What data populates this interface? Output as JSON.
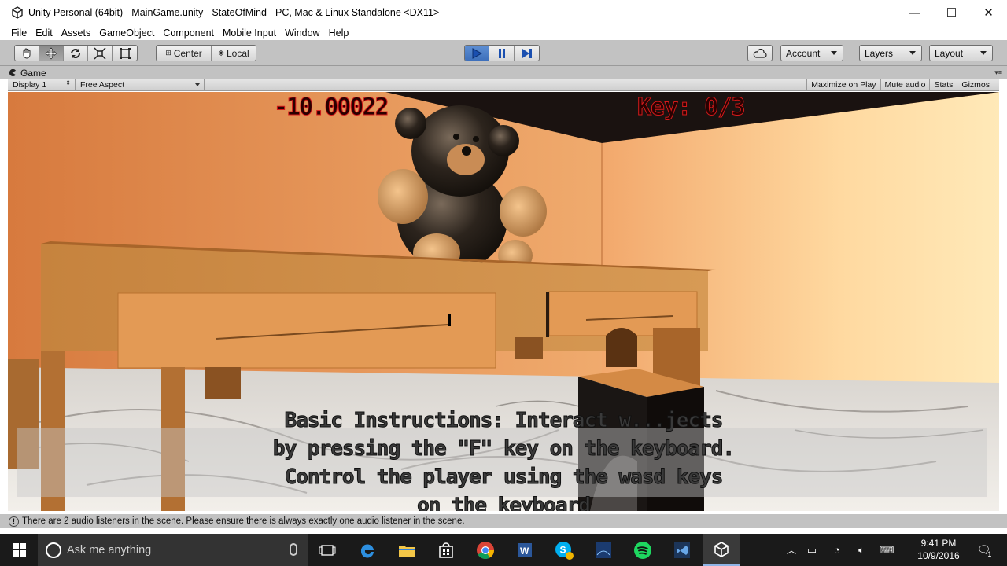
{
  "window": {
    "title": "Unity Personal (64bit) - MainGame.unity - StateOfMind - PC, Mac & Linux Standalone <DX11>",
    "minimize_glyph": "—",
    "maximize_glyph": "☐",
    "close_glyph": "✕"
  },
  "menu": [
    "File",
    "Edit",
    "Assets",
    "GameObject",
    "Component",
    "Mobile Input",
    "Window",
    "Help"
  ],
  "toolbar": {
    "transform_tools": [
      "hand-icon",
      "move-icon",
      "rotate-icon",
      "scale-icon",
      "rect-icon"
    ],
    "pivot_label": "Center",
    "space_label": "Local",
    "play_controls": [
      "play-icon",
      "pause-icon",
      "step-icon"
    ],
    "account_label": "Account",
    "layers_label": "Layers",
    "layout_label": "Layout"
  },
  "game_tab": {
    "label": "Game",
    "display_label": "Display 1",
    "aspect_label": "Free Aspect",
    "maximize_on_play": "Maximize on Play",
    "mute_audio": "Mute audio",
    "stats": "Stats",
    "gizmos": "Gizmos"
  },
  "hud": {
    "timer": "-10.00022",
    "keys": "Key: 0/3",
    "instructions": "Basic Instructions: Interact w...jects by pressing the \"F\" key on the keyboard. Control the player using the wasd keys on the keyboard"
  },
  "status": {
    "message": "There are 2 audio listeners in the scene. Please ensure there is always exactly one audio listener in the scene."
  },
  "taskbar": {
    "search_placeholder": "Ask me anything",
    "apps": [
      "task-view-icon",
      "edge-icon",
      "file-explorer-icon",
      "store-icon",
      "chrome-icon",
      "word-icon",
      "skype-icon",
      "kindle-icon",
      "spotify-icon",
      "visual-studio-icon",
      "unity-icon"
    ],
    "time": "9:41 PM",
    "date": "10/9/2016",
    "notification_count": "1"
  },
  "colors": {
    "unity_chrome": "#c2c2c2",
    "play_active": "#3d6fbb",
    "hud_red": "#d41a1a",
    "wall": "#e89a5a",
    "taskbar": "#1a1a1a"
  }
}
